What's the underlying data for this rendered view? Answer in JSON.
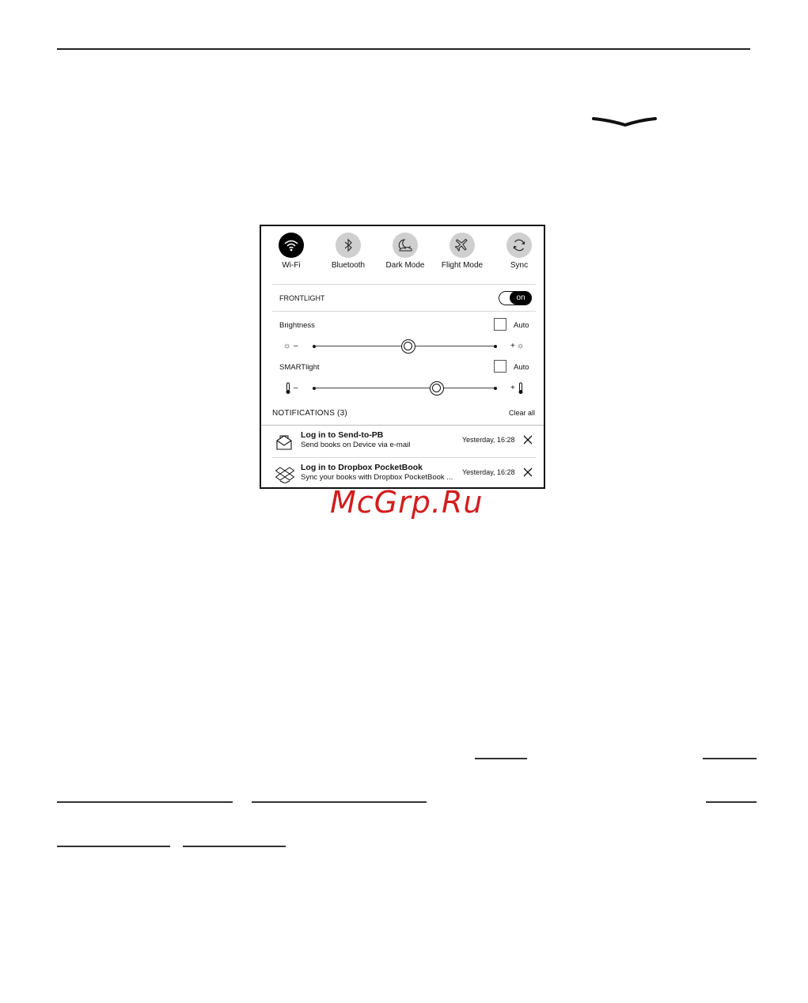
{
  "quick_settings": [
    {
      "label": "Wi-Fi",
      "icon": "wifi-icon",
      "active": true
    },
    {
      "label": "Bluetooth",
      "icon": "bluetooth-icon",
      "active": false
    },
    {
      "label": "Dark Mode",
      "icon": "moon-icon",
      "active": false
    },
    {
      "label": "Flight Mode",
      "icon": "airplane-icon",
      "active": false
    },
    {
      "label": "Sync",
      "icon": "sync-icon",
      "active": false
    }
  ],
  "frontlight": {
    "label": "FRONTLIGHT",
    "toggle_text": "on"
  },
  "brightness": {
    "label": "Brightness",
    "auto_label": "Auto",
    "minus": "–",
    "plus": "+",
    "value_fraction": 0.52
  },
  "smartlight": {
    "label": "SMARTlight",
    "auto_label": "Auto",
    "minus": "–",
    "plus": "+",
    "value_fraction": 0.68
  },
  "notifications": {
    "header": "NOTIFICATIONS (3)",
    "clear_all": "Clear all",
    "items": [
      {
        "title": "Log in to Send-to-PB",
        "subtitle": "Send books on Device via e-mail",
        "time": "Yesterday, 16:28",
        "icon": "envelope-icon"
      },
      {
        "title": "Log in to Dropbox PocketBook",
        "subtitle": "Sync your books with Dropbox PocketBook ...",
        "time": "Yesterday, 16:28",
        "icon": "dropbox-icon"
      }
    ]
  },
  "watermark": "McGrp.Ru"
}
